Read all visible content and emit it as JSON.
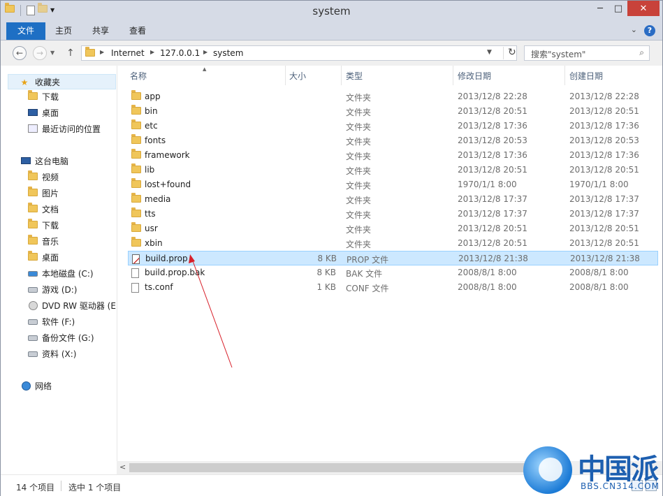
{
  "window": {
    "title": "system"
  },
  "ribbon": {
    "tabs": [
      "文件",
      "主页",
      "共享",
      "查看"
    ]
  },
  "address": {
    "crumbs": [
      "Internet",
      "127.0.0.1",
      "system"
    ],
    "search_placeholder": "搜索\"system\""
  },
  "nav": {
    "favorites": {
      "label": "收藏夹",
      "items": [
        "下载",
        "桌面",
        "最近访问的位置"
      ]
    },
    "thispc": {
      "label": "这台电脑",
      "items": [
        "视频",
        "图片",
        "文档",
        "下载",
        "音乐",
        "桌面",
        "本地磁盘 (C:)",
        "游戏 (D:)",
        "DVD RW 驱动器 (E",
        "软件 (F:)",
        "备份文件 (G:)",
        "资料 (X:)"
      ]
    },
    "network": {
      "label": "网络"
    }
  },
  "columns": {
    "name": "名称",
    "size": "大小",
    "type": "类型",
    "modified": "修改日期",
    "created": "创建日期"
  },
  "files": [
    {
      "name": "app",
      "size": "",
      "type": "文件夹",
      "modified": "2013/12/8 22:28",
      "created": "2013/12/8 22:28",
      "kind": "folder"
    },
    {
      "name": "bin",
      "size": "",
      "type": "文件夹",
      "modified": "2013/12/8 20:51",
      "created": "2013/12/8 20:51",
      "kind": "folder"
    },
    {
      "name": "etc",
      "size": "",
      "type": "文件夹",
      "modified": "2013/12/8 17:36",
      "created": "2013/12/8 17:36",
      "kind": "folder"
    },
    {
      "name": "fonts",
      "size": "",
      "type": "文件夹",
      "modified": "2013/12/8 20:53",
      "created": "2013/12/8 20:53",
      "kind": "folder"
    },
    {
      "name": "framework",
      "size": "",
      "type": "文件夹",
      "modified": "2013/12/8 17:36",
      "created": "2013/12/8 17:36",
      "kind": "folder"
    },
    {
      "name": "lib",
      "size": "",
      "type": "文件夹",
      "modified": "2013/12/8 20:51",
      "created": "2013/12/8 20:51",
      "kind": "folder"
    },
    {
      "name": "lost+found",
      "size": "",
      "type": "文件夹",
      "modified": "1970/1/1 8:00",
      "created": "1970/1/1 8:00",
      "kind": "folder"
    },
    {
      "name": "media",
      "size": "",
      "type": "文件夹",
      "modified": "2013/12/8 17:37",
      "created": "2013/12/8 17:37",
      "kind": "folder"
    },
    {
      "name": "tts",
      "size": "",
      "type": "文件夹",
      "modified": "2013/12/8 17:37",
      "created": "2013/12/8 17:37",
      "kind": "folder"
    },
    {
      "name": "usr",
      "size": "",
      "type": "文件夹",
      "modified": "2013/12/8 20:51",
      "created": "2013/12/8 20:51",
      "kind": "folder"
    },
    {
      "name": "xbin",
      "size": "",
      "type": "文件夹",
      "modified": "2013/12/8 20:51",
      "created": "2013/12/8 20:51",
      "kind": "folder"
    },
    {
      "name": "build.prop",
      "size": "8 KB",
      "type": "PROP 文件",
      "modified": "2013/12/8 21:38",
      "created": "2013/12/8 21:38",
      "kind": "prop"
    },
    {
      "name": "build.prop.bak",
      "size": "8 KB",
      "type": "BAK 文件",
      "modified": "2008/8/1 8:00",
      "created": "2008/8/1 8:00",
      "kind": "file"
    },
    {
      "name": "ts.conf",
      "size": "1 KB",
      "type": "CONF 文件",
      "modified": "2008/8/1 8:00",
      "created": "2008/8/1 8:00",
      "kind": "file"
    }
  ],
  "status": {
    "count": "14 个项目",
    "selected": "选中 1 个项目"
  },
  "watermark": {
    "text": "中国派",
    "url": "BBS.CN314.COM"
  }
}
